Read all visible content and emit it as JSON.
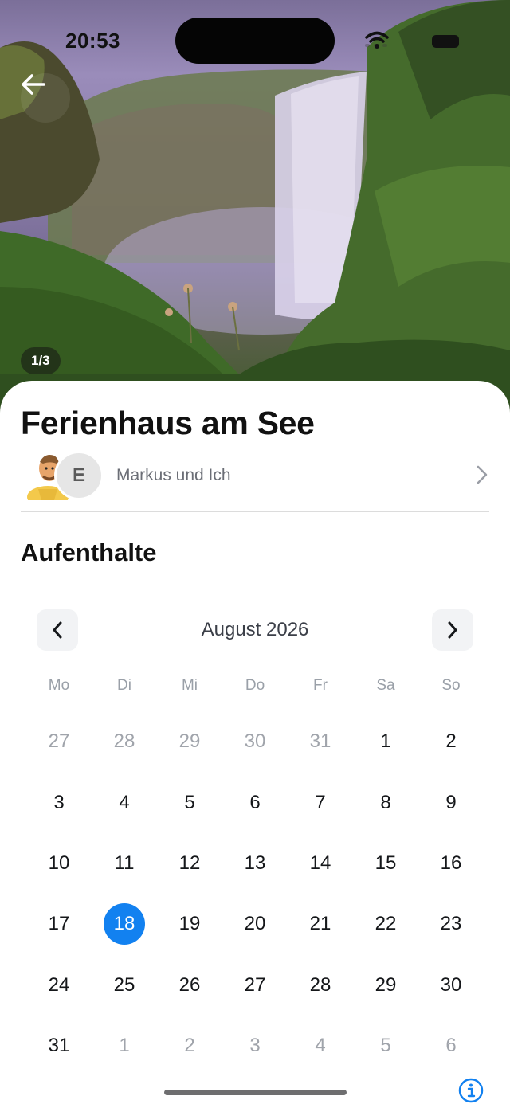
{
  "status_bar": {
    "time": "20:53"
  },
  "hero": {
    "page_counter": "1/3"
  },
  "title": "Ferienhaus am See",
  "members": {
    "avatar_initial": "E",
    "label": "Markus und Ich"
  },
  "section_title": "Aufenthalte",
  "calendar": {
    "month": "August 2026",
    "weekdays": [
      "Mo",
      "Di",
      "Mi",
      "Do",
      "Fr",
      "Sa",
      "So"
    ],
    "days": [
      {
        "d": "27",
        "muted": true
      },
      {
        "d": "28",
        "muted": true
      },
      {
        "d": "29",
        "muted": true
      },
      {
        "d": "30",
        "muted": true
      },
      {
        "d": "31",
        "muted": true
      },
      {
        "d": "1"
      },
      {
        "d": "2"
      },
      {
        "d": "3"
      },
      {
        "d": "4"
      },
      {
        "d": "5"
      },
      {
        "d": "6"
      },
      {
        "d": "7"
      },
      {
        "d": "8"
      },
      {
        "d": "9"
      },
      {
        "d": "10"
      },
      {
        "d": "11"
      },
      {
        "d": "12"
      },
      {
        "d": "13"
      },
      {
        "d": "14"
      },
      {
        "d": "15"
      },
      {
        "d": "16"
      },
      {
        "d": "17"
      },
      {
        "d": "18",
        "selected": true
      },
      {
        "d": "19"
      },
      {
        "d": "20"
      },
      {
        "d": "21"
      },
      {
        "d": "22"
      },
      {
        "d": "23"
      },
      {
        "d": "24"
      },
      {
        "d": "25"
      },
      {
        "d": "26"
      },
      {
        "d": "27"
      },
      {
        "d": "28"
      },
      {
        "d": "29"
      },
      {
        "d": "30"
      },
      {
        "d": "31"
      },
      {
        "d": "1",
        "muted": true
      },
      {
        "d": "2",
        "muted": true
      },
      {
        "d": "3",
        "muted": true
      },
      {
        "d": "4",
        "muted": true
      },
      {
        "d": "5",
        "muted": true
      },
      {
        "d": "6",
        "muted": true
      }
    ]
  },
  "colors": {
    "accent": "#1281f0",
    "muted_text": "#a0a4ab"
  }
}
